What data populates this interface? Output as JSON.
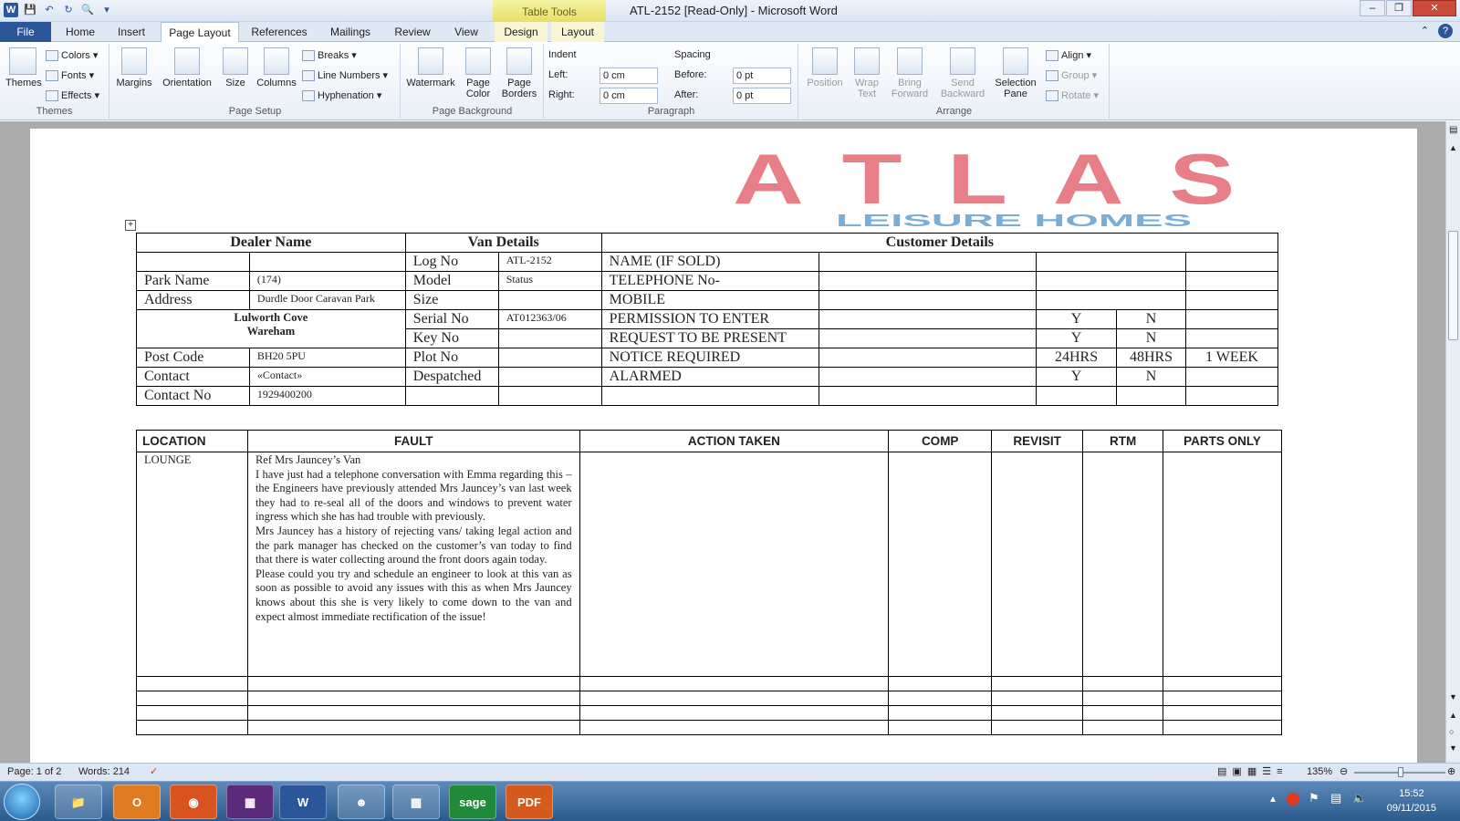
{
  "window": {
    "title": "ATL-2152 [Read-Only] - Microsoft Word",
    "context_tab_group": "Table Tools"
  },
  "tabs": [
    "File",
    "Home",
    "Insert",
    "Page Layout",
    "References",
    "Mailings",
    "Review",
    "View",
    "Design",
    "Layout"
  ],
  "ribbon": {
    "themes": {
      "label": "Themes",
      "themes_btn": "Themes",
      "colors": "Colors",
      "fonts": "Fonts",
      "effects": "Effects"
    },
    "page_setup": {
      "label": "Page Setup",
      "margins": "Margins",
      "orientation": "Orientation",
      "size": "Size",
      "columns": "Columns",
      "breaks": "Breaks",
      "line_numbers": "Line Numbers",
      "hyphenation": "Hyphenation"
    },
    "page_background": {
      "label": "Page Background",
      "watermark": "Watermark",
      "page_color": "Page Color",
      "page_borders": "Page Borders"
    },
    "paragraph": {
      "label": "Paragraph",
      "indent": "Indent",
      "left_label": "Left:",
      "left_value": "0 cm",
      "right_label": "Right:",
      "right_value": "0 cm",
      "spacing": "Spacing",
      "before_label": "Before:",
      "before_value": "0 pt",
      "after_label": "After:",
      "after_value": "0 pt"
    },
    "arrange": {
      "label": "Arrange",
      "position": "Position",
      "wrap_text": "Wrap Text",
      "bring_forward": "Bring Forward",
      "send_backward": "Send Backward",
      "selection_pane": "Selection Pane",
      "align": "Align",
      "group": "Group",
      "rotate": "Rotate"
    }
  },
  "logo": {
    "brand": "ATLAS",
    "tagline": "LEISURE HOMES",
    "color": "#e87f88",
    "tagline_color": "#7aaed6"
  },
  "job_table": {
    "headers": {
      "dealer": "Dealer Name",
      "van": "Van Details",
      "customer": "Customer Details"
    },
    "park_name_label": "Park Name",
    "park_name_value": "(174)",
    "address_label": "Address",
    "address_value": "Durdle Door Caravan Park",
    "address_line2": "Lulworth Cove",
    "address_line3": "Wareham",
    "postcode_label": "Post Code",
    "postcode_value": "BH20 5PU",
    "contact_label": "Contact",
    "contact_value": "«Contact»",
    "contact_no_label": "Contact No",
    "contact_no_value": "1929400200",
    "log_no_label": "Log No",
    "log_no_value": "ATL-2152",
    "model_label": "Model",
    "model_value": "Status",
    "size_label": "Size",
    "serial_label": "Serial No",
    "serial_value": "AT012363/06",
    "key_label": "Key No",
    "plot_label": "Plot No",
    "despatched_label": "Despatched",
    "name_label": "NAME (IF SOLD)",
    "telephone_label": "TELEPHONE No-",
    "mobile_label": "MOBILE",
    "permission_label": "PERMISSION TO ENTER",
    "request_label": "REQUEST TO BE PRESENT",
    "notice_label": "NOTICE REQUIRED",
    "alarmed_label": "ALARMED",
    "yes": "Y",
    "no": "N",
    "hrs24": "24HRS",
    "hrs48": "48HRS",
    "week": "1 WEEK"
  },
  "fault_table": {
    "headers": [
      "LOCATION",
      "FAULT",
      "ACTION TAKEN",
      "COMP",
      "REVISIT",
      "RTM",
      "PARTS ONLY"
    ],
    "location": "LOUNGE",
    "fault_lines": [
      "Ref Mrs Jauncey’s Van",
      "I have just had a telephone conversation with Emma regarding this – the Engineers have previously attended Mrs Jauncey’s van last week they had to re-seal all of the doors and windows to prevent water ingress which she has had trouble with previously.",
      "Mrs Jauncey has a history of rejecting vans/ taking legal action and the park manager has checked on the customer’s van today to find that there is water collecting around the front doors again today.",
      "Please could you try and schedule an engineer to look at this van as soon as possible to avoid any issues with this as when Mrs Jauncey knows about this she is very likely to come down to the van and expect almost immediate rectification of the issue!"
    ]
  },
  "status_bar": {
    "page": "Page: 1 of 2",
    "words": "Words: 214",
    "zoom": "135%"
  },
  "taskbar": {
    "time": "15:52",
    "date": "09/11/2015",
    "apps": [
      "Explorer",
      "Outlook",
      "Firefox",
      "Calculator",
      "Word",
      "Contacts",
      "Calc",
      "sage",
      "PDF"
    ]
  }
}
